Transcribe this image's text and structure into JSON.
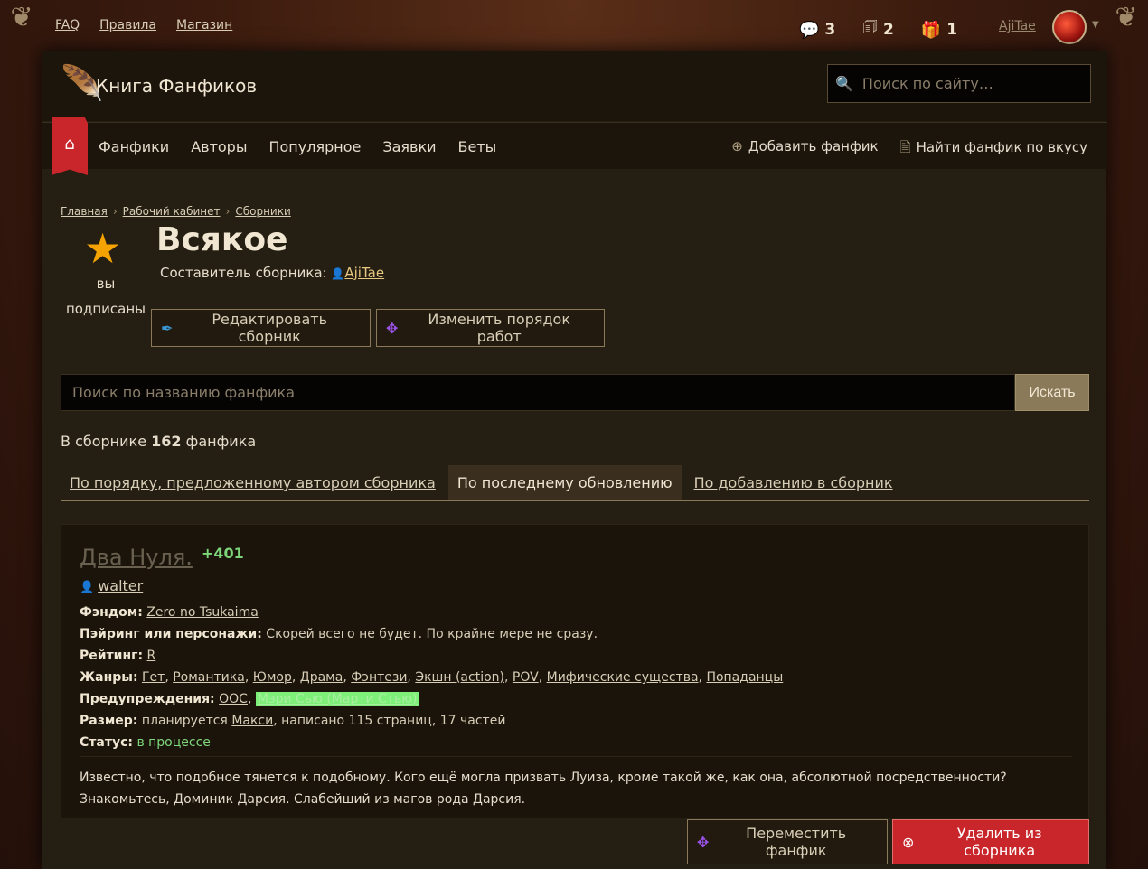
{
  "topnav": {
    "faq": "FAQ",
    "rules": "Правила",
    "shop": "Магазин"
  },
  "counters": [
    {
      "icon": "chat-bubbles-icon",
      "value": "3"
    },
    {
      "icon": "notification-cards-icon",
      "value": "2"
    },
    {
      "icon": "gift-icon",
      "value": "1"
    }
  ],
  "user": {
    "name": "AjiTae"
  },
  "header": {
    "site_title": "Книга Фанфиков",
    "search_placeholder": "Поиск по сайту…"
  },
  "mainnav": [
    "Фанфики",
    "Авторы",
    "Популярное",
    "Заявки",
    "Беты"
  ],
  "rightnav": {
    "add": "Добавить фанфик",
    "find": "Найти фанфик по вкусу"
  },
  "breadcrumb": [
    "Главная",
    "Рабочий кабинет",
    "Сборники"
  ],
  "collection": {
    "subscribed_label": "вы подписаны",
    "title": "Всякое",
    "compiler_label": "Составитель сборника:",
    "compiler_name": "AjiTae",
    "edit_label": "Редактировать сборник",
    "reorder_label": "Изменить порядок работ",
    "search_placeholder": "Поиск по названию фанфика",
    "search_button": "Искать",
    "count_prefix": "В сборнике",
    "count_value": "162",
    "count_suffix": "фанфика"
  },
  "sort_tabs": [
    {
      "label": "По порядку, предложенному автором сборника",
      "active": false
    },
    {
      "label": "По последнему обновлению",
      "active": true
    },
    {
      "label": "По добавлению в сборник",
      "active": false
    }
  ],
  "fic": {
    "title": "Два Нуля.",
    "score": "+401",
    "author": "walter",
    "fandom_label": "Фэндом:",
    "fandom": "Zero no Tsukaima",
    "pairing_label": "Пэйринг или персонажи:",
    "pairing": "Скорей всего не будет. По крайне мере не сразу.",
    "rating_label": "Рейтинг:",
    "rating": "R",
    "genres_label": "Жанры:",
    "genres": [
      "Гет",
      "Романтика",
      "Юмор",
      "Драма",
      "Фэнтези",
      "Экшн (action)",
      "POV",
      "Мифические существа",
      "Попаданцы"
    ],
    "warnings_label": "Предупреждения:",
    "warnings": [
      "OOC",
      "Мэри Сью (Марти Стью)"
    ],
    "size_label": "Размер:",
    "size_planned": "планируется",
    "size_link": "Макси",
    "size_rest": ", написано 115 страниц, 17 частей",
    "status_label": "Статус:",
    "status": "в процессе",
    "description": "Известно, что подобное тянется к подобному. Кого ещё могла призвать Луиза, кроме такой же, как она, абсолютной посредственности? Знакомьтесь, Доминик Дарсия. Слабейший из магов рода Дарсия."
  },
  "actions": {
    "move": "Переместить фанфик",
    "delete": "Удалить из сборника"
  },
  "colors": {
    "accent_red": "#c8262a",
    "star": "#f5a300",
    "score_green": "#7ed67a"
  }
}
